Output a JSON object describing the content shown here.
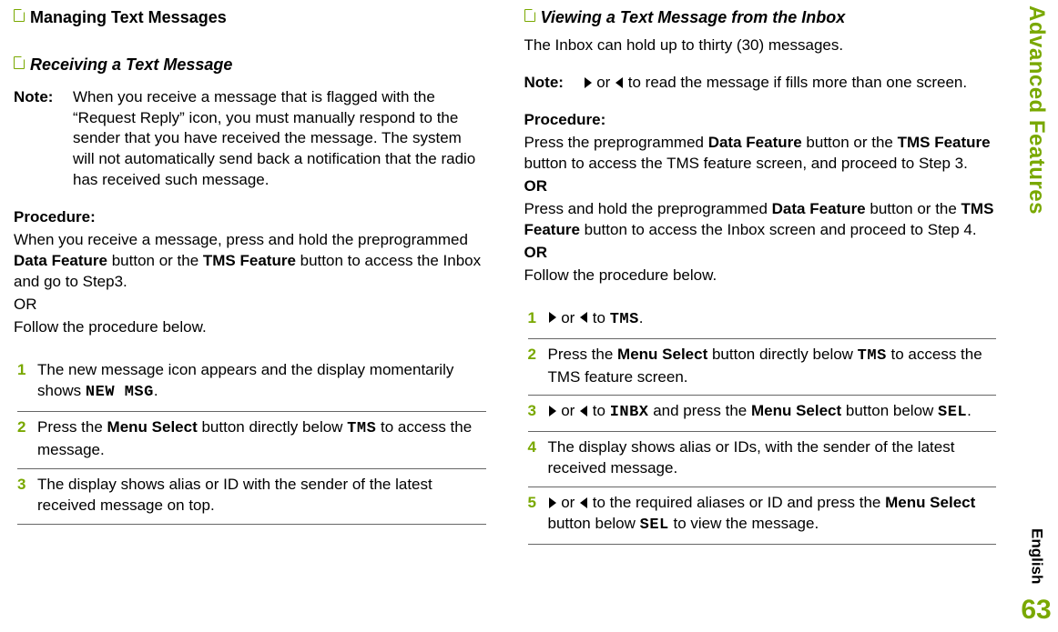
{
  "sidebar": {
    "title": "Advanced Features",
    "language": "English",
    "page": "63"
  },
  "left": {
    "h1": "Managing Text Messages",
    "h2": "Receiving a Text Message",
    "note_label": "Note:",
    "note_body": "When you receive a message that is flagged with the “Request Reply” icon, you must manually respond to the sender that you have received the message. The system will not automatically send back a notification that the radio has received such message.",
    "proc_label": "Procedure:",
    "proc_intro_1a": "When you receive a message, press and hold the preprogrammed ",
    "proc_intro_1b": "Data Feature",
    "proc_intro_1c": " button or the ",
    "proc_intro_1d": "TMS Feature",
    "proc_intro_1e": " button to access the Inbox and go to Step3.",
    "proc_intro_2": "OR",
    "proc_intro_3": "Follow the procedure below.",
    "steps": [
      {
        "num": "1",
        "a": "The new message icon appears and the display momentarily shows ",
        "lcd": "NEW MSG",
        "z": "."
      },
      {
        "num": "2",
        "a": "Press the ",
        "b": "Menu Select",
        "c": " button directly below ",
        "lcd": "TMS",
        "z": " to access the message."
      },
      {
        "num": "3",
        "a": "The display shows alias or ID with the sender of the latest received message on top."
      }
    ]
  },
  "right": {
    "h2": "Viewing a Text Message from the Inbox",
    "intro": "The Inbox can hold up to thirty (30) messages.",
    "note_label": "Note:",
    "note_mid": " or ",
    "note_tail": " to read the message if fills more than one screen.",
    "proc_label": "Procedure:",
    "p1a": "Press the preprogrammed ",
    "p1b": "Data Feature",
    "p1c": " button or the ",
    "p1d": "TMS Feature",
    "p1e": " button to access the TMS feature screen, and proceed to Step 3.",
    "or1": "OR",
    "p2a": "Press and hold the preprogrammed ",
    "p2b": "Data Feature",
    "p2c": " button or the ",
    "p2d": "TMS Feature",
    "p2e": " button to access the Inbox screen and proceed to Step 4.",
    "or2": "OR",
    "p3": "Follow the procedure below.",
    "steps": {
      "s1": {
        "num": "1",
        "mid": " or ",
        "tail_to": " to ",
        "lcd": "TMS",
        "z": "."
      },
      "s2": {
        "num": "2",
        "a": "Press the ",
        "b": "Menu Select",
        "c": " button directly below ",
        "lcd": "TMS",
        "z": " to access the TMS feature screen."
      },
      "s3": {
        "num": "3",
        "mid": " or ",
        "tail_to": " to ",
        "lcd1": "INBX",
        "d": " and press the ",
        "e": "Menu Select",
        "f": " button below ",
        "lcd2": "SEL",
        "z": "."
      },
      "s4": {
        "num": "4",
        "a": "The display shows alias or IDs, with the sender of the latest received message."
      },
      "s5": {
        "num": "5",
        "mid": " or ",
        "d": " to the required aliases or ID and press the ",
        "e": "Menu Select",
        "f": " button below ",
        "lcd": "SEL",
        "z": " to view the message."
      }
    }
  }
}
